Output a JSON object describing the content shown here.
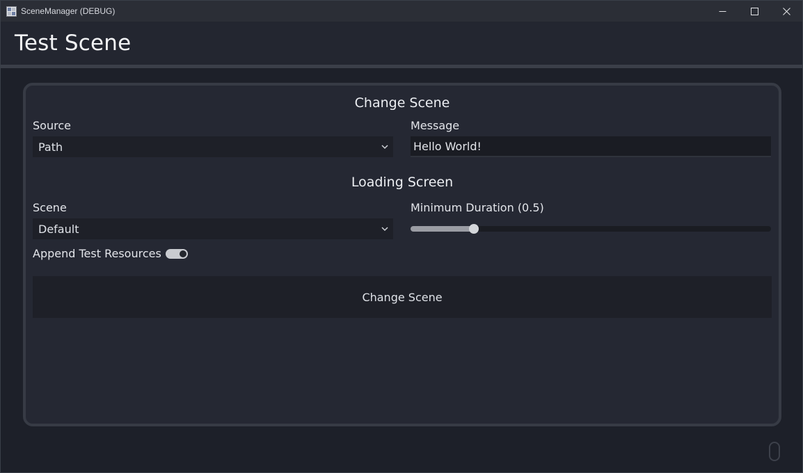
{
  "window": {
    "title": "SceneManager (DEBUG)",
    "controls": [
      "minimize-icon",
      "maximize-icon",
      "close-icon"
    ]
  },
  "header": {
    "title": "Test Scene"
  },
  "change_scene": {
    "section_title": "Change Scene",
    "source": {
      "label": "Source",
      "selected": "Path"
    },
    "message": {
      "label": "Message",
      "value": "Hello World!"
    }
  },
  "loading_screen": {
    "section_title": "Loading Screen",
    "scene": {
      "label": "Scene",
      "selected": "Default"
    },
    "minimum_duration": {
      "label": "Minimum Duration (0.5)",
      "fraction": 0.175
    },
    "append_test_resources": {
      "label": "Append Test Resources",
      "enabled": true
    }
  },
  "action_button": {
    "label": "Change Scene"
  },
  "colors": {
    "background": "#1d2029",
    "panel": "#252833",
    "input": "#1e2028",
    "text": "#dfe2e8"
  }
}
